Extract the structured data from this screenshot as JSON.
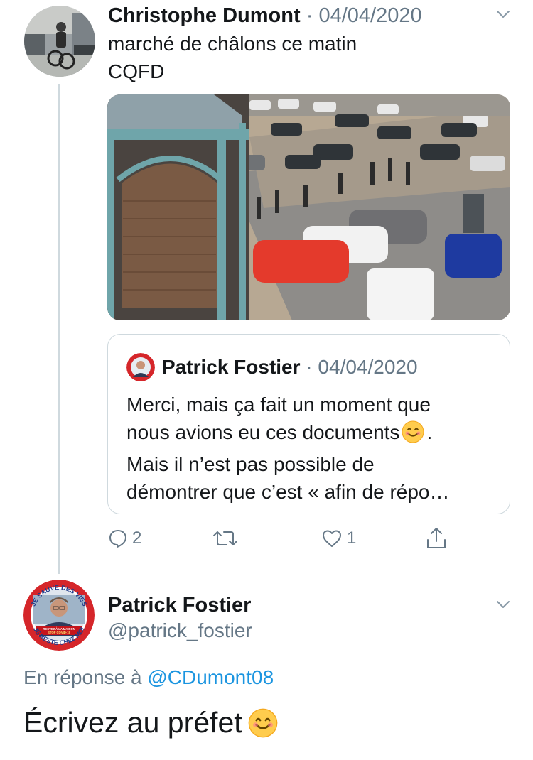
{
  "tweet": {
    "author_name": "Christophe Dumont",
    "separator": " · ",
    "date": "04/04/2020",
    "text_lines": [
      "marché de châlons ce matin",
      "CQFD"
    ]
  },
  "quoted_tweet": {
    "author_name": "Patrick Fostier",
    "separator": " · ",
    "date": "04/04/2020",
    "text_lines": [
      "Merci, mais ça fait un moment que",
      "nous avions eu ces documents",
      ".",
      "Mais il n’est pas possible de",
      "démontrer que c’est « afin de répo…"
    ]
  },
  "actions": {
    "reply_count": "2",
    "retweet_count": "",
    "like_count": "1"
  },
  "reply_tweet": {
    "author_name": "Patrick Fostier",
    "handle": "@patrick_fostier",
    "in_reply_to_label": "En réponse à ",
    "in_reply_to_handle": "@CDumont08",
    "text": "Écrivez au préfet",
    "avatar_badge_top": "JE SAUVE DES VIES",
    "avatar_badge_bottom": "JE RESTE CHEZ MOI",
    "avatar_badge_center": [
      "RESTEZ À LA MAISON",
      "STOP COVID-19"
    ]
  },
  "icons": {
    "caret": "chevron-down-icon",
    "reply": "reply-icon",
    "retweet": "retweet-icon",
    "like": "heart-icon",
    "share": "share-icon",
    "emoji": "smiling-face-emoji"
  },
  "colors": {
    "text_primary": "#14171a",
    "text_secondary": "#657786",
    "link": "#1b95e0",
    "border": "#cfd9de",
    "thread_line": "#cfd9de"
  }
}
